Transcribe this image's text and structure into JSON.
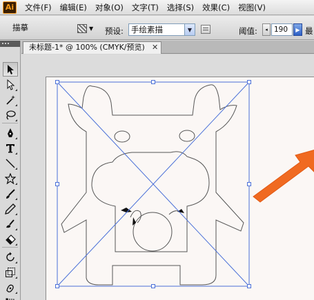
{
  "app": {
    "logo_text": "Ai",
    "accent": "#f59a1b"
  },
  "menu": [
    "文件(F)",
    "编辑(E)",
    "对象(O)",
    "文字(T)",
    "选择(S)",
    "效果(C)",
    "视图(V)"
  ],
  "control_bar": {
    "mode_title": "描摹",
    "preset_label": "预设:",
    "preset_value": "手绘素描",
    "threshold_label": "阈值:",
    "threshold_value": "190",
    "min_label": "最"
  },
  "document": {
    "tab_title": "未标题-1* @ 100% (CMYK/预览)",
    "close_glyph": "✕"
  },
  "tools": [
    "selection-tool",
    "direct-selection-tool",
    "magic-wand-tool",
    "lasso-tool",
    "pen-tool",
    "type-tool",
    "line-tool",
    "star-tool",
    "paintbrush-tool",
    "pencil-tool",
    "blob-brush-tool",
    "eraser-tool",
    "rotate-tool",
    "scale-tool",
    "warp-tool",
    "free-transform-tool"
  ],
  "colors": {
    "selection": "#4a6fd8",
    "annotation_arrow": "#f06a21",
    "path_stroke": "#555555"
  }
}
